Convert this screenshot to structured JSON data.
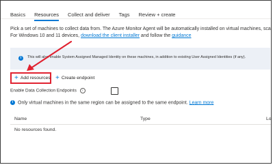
{
  "tabs": [
    {
      "label": "Basics"
    },
    {
      "label": "Resources"
    },
    {
      "label": "Collect and deliver"
    },
    {
      "label": "Tags"
    },
    {
      "label": "Review + create"
    }
  ],
  "description": {
    "line1": "Pick a set of machines to collect data from. The Azure Monitor Agent will be automatically installed on virtual machines, sca",
    "line2_prefix": "For Windows 10 and 11 devices, ",
    "line2_link1": "download the client installer",
    "line2_middle": " and follow the ",
    "line2_link2": "guidance"
  },
  "banner": {
    "text": "This will also enable System Assigned Managed Identity on these machines, in addition to existing User Assigned Identities (if any)."
  },
  "toolbar": {
    "add_resources": "Add resources",
    "create_endpoint": "Create endpoint"
  },
  "dce": {
    "label": "Enable Data Collection Endpoints",
    "checked": false
  },
  "notice": {
    "text": "Only virtual machines in the same region can be assigned to the same endpoint. ",
    "link": "Learn more"
  },
  "table": {
    "columns": [
      "Name",
      "Type",
      "Lo"
    ],
    "empty_text": "No resources found."
  },
  "colors": {
    "accent": "#0078d4",
    "highlight": "#e0212f"
  }
}
